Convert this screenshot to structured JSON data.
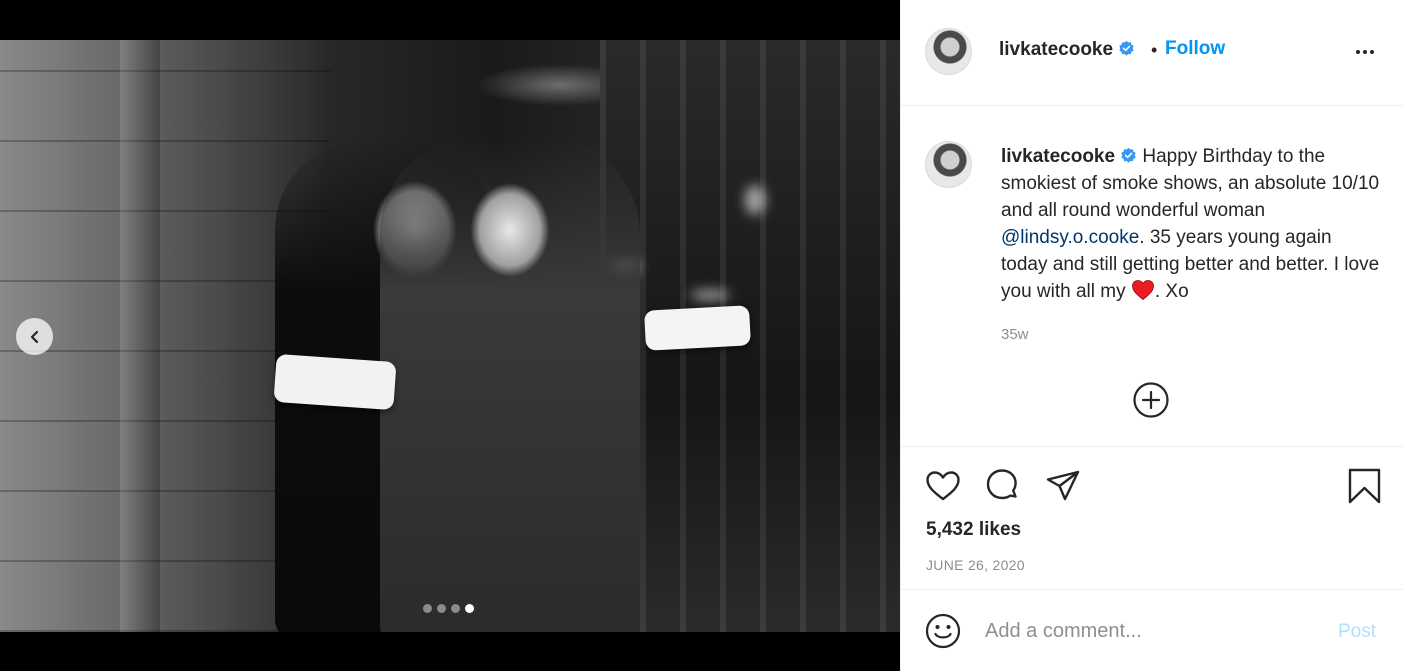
{
  "post": {
    "username": "livkatecooke",
    "follow_label": "Follow",
    "separator": "•",
    "caption_text_1": "Happy Birthday to the smokiest of smoke shows, an absolute 10/10 and all round wonderful woman ",
    "mention": "@lindsy.o.cooke",
    "caption_text_2": ". 35 years young again today and still getting better and better. I love you with all my ",
    "caption_text_3": ". Xo",
    "age": "35w",
    "likes": "5,432 likes",
    "date": "JUNE 26, 2020"
  },
  "media": {
    "slide_count": 4,
    "active_slide": 4
  },
  "comment": {
    "placeholder": "Add a comment...",
    "post_label": "Post"
  },
  "icons": {
    "verified": "verified-badge-icon",
    "more": "more-options-icon",
    "like": "heart-icon",
    "comment": "comment-icon",
    "share": "share-icon",
    "save": "bookmark-icon",
    "load_more": "plus-circle-icon",
    "emoji": "emoji-icon",
    "prev": "chevron-left-icon"
  },
  "colors": {
    "accent": "#0095f6",
    "verified": "#3897f0",
    "post_disabled": "#b2dffc",
    "emoji_heart": "#ed1c24"
  }
}
